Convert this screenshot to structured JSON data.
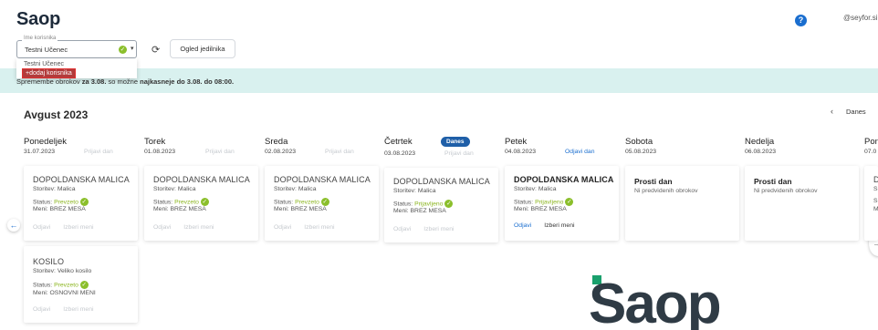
{
  "header": {
    "logo": "Saop",
    "help_icon": "?",
    "user_email": "@seyfor.si"
  },
  "user_select": {
    "label": "Ime korisnika",
    "value": "Testni Učenec",
    "options": [
      "Testni Učenec"
    ],
    "add_option": "+dodaj korisnika"
  },
  "toolbar": {
    "menu_view_label": "Ogled jedilnika"
  },
  "notice": {
    "prefix": "Spremembe obrokov",
    "date": "za 3.08.",
    "middle": "so možne",
    "deadline": "najkasneje do 3.08. do 08:00."
  },
  "calendar": {
    "month": "Avgust 2023",
    "today_label": "Danes",
    "today_badge": "Danes",
    "days": [
      {
        "name": "Ponedeljek",
        "date": "31.07.2023",
        "action": "Prijavi dan"
      },
      {
        "name": "Torek",
        "date": "01.08.2023",
        "action": "Prijavi dan"
      },
      {
        "name": "Sreda",
        "date": "02.08.2023",
        "action": "Prijavi dan"
      },
      {
        "name": "Četrtek",
        "date": "03.08.2023",
        "action": "Prijavi dan"
      },
      {
        "name": "Petek",
        "date": "04.08.2023",
        "action": "Odjavi dan"
      },
      {
        "name": "Sobota",
        "date": "05.08.2023",
        "action": ""
      },
      {
        "name": "Nedelja",
        "date": "06.08.2023",
        "action": ""
      },
      {
        "name": "Pon",
        "date": "07.0",
        "action": ""
      }
    ]
  },
  "meals": {
    "labels": {
      "service": "Storitev:",
      "status": "Status:",
      "menu": "Meni:",
      "cancel": "Odjavi",
      "choose": "Izberi meni"
    },
    "breakfast": [
      {
        "title": "DOPOLDANSKA MALICA",
        "service": "Malica",
        "status": "Prevzeto",
        "menu": "BREZ MESA"
      },
      {
        "title": "DOPOLDANSKA MALICA",
        "service": "Malica",
        "status": "Prevzeto",
        "menu": "BREZ MESA"
      },
      {
        "title": "DOPOLDANSKA MALICA",
        "service": "Malica",
        "status": "Prevzeto",
        "menu": "BREZ MESA"
      },
      {
        "title": "DOPOLDANSKA MALICA",
        "service": "Malica",
        "status": "Prijavljeno",
        "menu": "BREZ MESA"
      },
      {
        "title": "DOPOLDANSKA MALICA",
        "service": "Malica",
        "status": "Prijavljeno",
        "menu": "BREZ MESA"
      }
    ],
    "free_days": [
      {
        "title": "Prosti dan",
        "subtitle": "Ni predvidenih obrokov"
      },
      {
        "title": "Prosti dan",
        "subtitle": "Ni predvidenih obrokov"
      }
    ],
    "partial_card_letters": [
      "D",
      "S",
      "S",
      "M"
    ],
    "lunch": {
      "title": "KOSILO",
      "service": "Veliko kosilo",
      "status": "Prevzeto",
      "menu": "OSNOVNI MENI"
    }
  },
  "watermark": {
    "text": "Saop"
  },
  "colors": {
    "accent": "#1a6ecf",
    "status_green": "#8bb51f",
    "banner": "#d9f1ef",
    "badge": "#1f5fa8",
    "brand_dark": "#2f3b45",
    "brand_green": "#1aa06d"
  }
}
